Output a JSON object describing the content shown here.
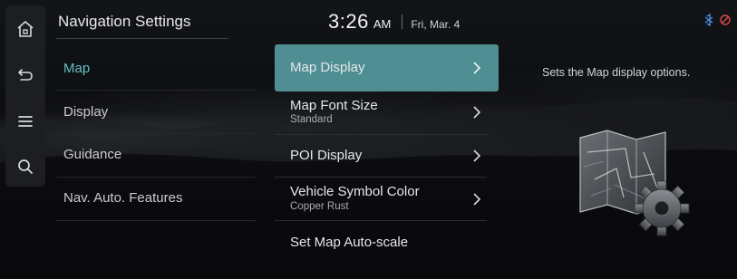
{
  "header": {
    "title": "Navigation Settings",
    "time": "3:26",
    "ampm": "AM",
    "date": "Fri, Mar. 4"
  },
  "rail": {
    "items": [
      {
        "icon": "home-icon"
      },
      {
        "icon": "back-icon"
      },
      {
        "icon": "menu-icon"
      },
      {
        "icon": "search-icon"
      }
    ]
  },
  "status_icons": [
    "bluetooth-phone-icon",
    "muted-icon"
  ],
  "categories": [
    {
      "label": "Map",
      "active": true
    },
    {
      "label": "Display"
    },
    {
      "label": "Guidance"
    },
    {
      "label": "Nav. Auto. Features"
    }
  ],
  "submenu": [
    {
      "label": "Map Display",
      "active": true
    },
    {
      "label": "Map Font Size",
      "value": "Standard"
    },
    {
      "label": "POI Display"
    },
    {
      "label": "Vehicle Symbol Color",
      "value": "Copper Rust"
    },
    {
      "label": "Set Map Auto-scale"
    }
  ],
  "description": "Sets the Map display options.",
  "colors": {
    "accent": "#62c2c6",
    "selected_bg": "#4f8f94",
    "background": "#0c0d10"
  }
}
